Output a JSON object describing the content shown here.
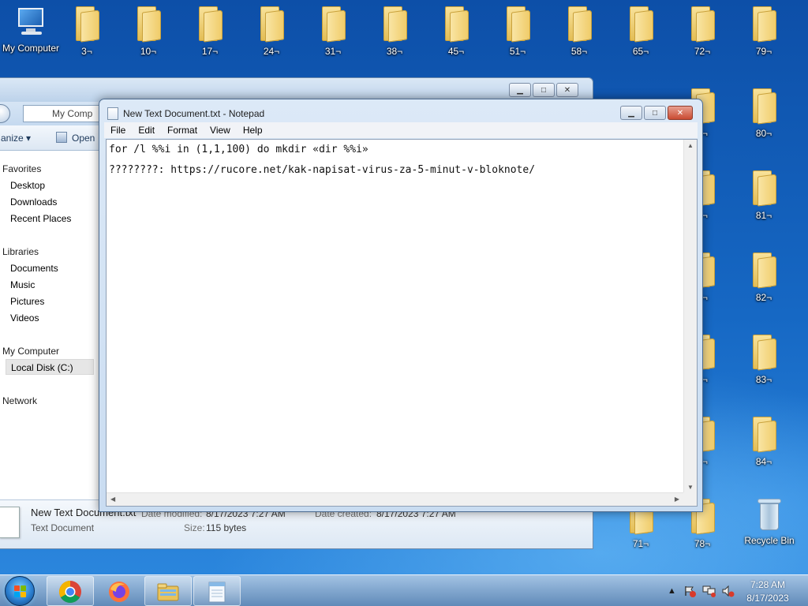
{
  "desktop": {
    "icons": [
      {
        "label": "My Computer",
        "kind": "computer"
      },
      {
        "label": "3¬",
        "kind": "folder"
      },
      {
        "label": "10¬",
        "kind": "folder"
      },
      {
        "label": "17¬",
        "kind": "folder"
      },
      {
        "label": "24¬",
        "kind": "folder"
      },
      {
        "label": "31¬",
        "kind": "folder"
      },
      {
        "label": "38¬",
        "kind": "folder"
      },
      {
        "label": "45¬",
        "kind": "folder"
      },
      {
        "label": "51¬",
        "kind": "folder"
      },
      {
        "label": "58¬",
        "kind": "folder"
      },
      {
        "label": "65¬",
        "kind": "folder"
      },
      {
        "label": "72¬",
        "kind": "folder"
      },
      {
        "label": "79¬",
        "kind": "folder"
      },
      {
        "label": "80¬",
        "kind": "folder"
      },
      {
        "label": "81¬",
        "kind": "folder"
      },
      {
        "label": "82¬",
        "kind": "folder"
      },
      {
        "label": "83¬",
        "kind": "folder"
      },
      {
        "label": "84¬",
        "kind": "folder"
      },
      {
        "label": "71¬",
        "kind": "folder"
      },
      {
        "label": "78¬",
        "kind": "folder"
      },
      {
        "label": "Recycle Bin",
        "kind": "recycle-bin"
      },
      {
        "label": "3¬",
        "kind": "folder"
      },
      {
        "label": "4¬",
        "kind": "folder"
      },
      {
        "label": "5¬",
        "kind": "folder"
      },
      {
        "label": "6¬",
        "kind": "folder"
      },
      {
        "label": "7¬",
        "kind": "folder"
      }
    ]
  },
  "explorer": {
    "address_text": "My Comp",
    "toolbar": {
      "organize": "anize ▾",
      "open": "Open"
    },
    "nav": {
      "favorites": "Favorites",
      "desktop": "Desktop",
      "downloads": "Downloads",
      "recent": "Recent Places",
      "libraries": "Libraries",
      "documents": "Documents",
      "music": "Music",
      "pictures": "Pictures",
      "videos": "Videos",
      "computer": "My Computer",
      "local_disk": "Local Disk (C:)",
      "network": "Network"
    },
    "details": {
      "file_name": "New Text Document.txt",
      "file_type": "Text Document",
      "date_modified_label": "Date modified:",
      "date_modified": "8/17/2023 7:27 AM",
      "date_created_label": "Date created:",
      "date_created": "8/17/2023 7:27 AM",
      "size_label": "Size:",
      "size": "115 bytes"
    }
  },
  "notepad": {
    "title": "New Text Document.txt - Notepad",
    "menu": [
      "File",
      "Edit",
      "Format",
      "View",
      "Help"
    ],
    "lines": [
      "for /l %%i in (1,1,100) do mkdir «dir %%i»",
      "????????: https://rucore.net/kak-napisat-virus-za-5-minut-v-bloknote/"
    ]
  },
  "taskbar": {
    "apps": [
      {
        "name": "chrome-icon"
      },
      {
        "name": "firefox-icon"
      },
      {
        "name": "file-explorer-icon"
      },
      {
        "name": "notepad-icon"
      }
    ],
    "clock_time": "7:28 AM",
    "clock_date": "8/17/2023",
    "colors": {
      "accent": "#1664b4"
    }
  }
}
